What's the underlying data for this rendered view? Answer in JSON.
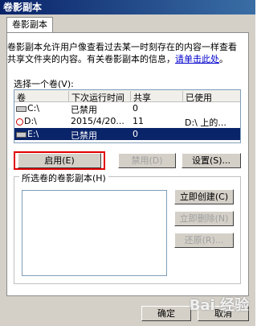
{
  "window": {
    "title": "卷影副本",
    "tab": "卷影副本"
  },
  "description": {
    "text": "卷影副本允许用户像查看过去某一时刻存在的内容一样查看共享文件夹的内容。有关卷影副本的信息，",
    "link": "请单击此处",
    "end": "。"
  },
  "volume_list": {
    "label": "选择一个卷(V):",
    "columns": [
      "卷",
      "下次运行时间",
      "共享",
      "已使用"
    ],
    "rows": [
      {
        "vol": "C:\\",
        "next": "已禁用",
        "shares": "0",
        "used": "",
        "icon": "drive-icon",
        "selected": false
      },
      {
        "vol": "D:\\",
        "next": "2015/4/20...",
        "shares": "11",
        "used": "D:\\ 上的...",
        "icon": "clock-drive-icon",
        "selected": false
      },
      {
        "vol": "E:\\",
        "next": "已禁用",
        "shares": "0",
        "used": "",
        "icon": "drive-icon",
        "selected": true
      }
    ]
  },
  "buttons": {
    "enable": "启用(E)",
    "disable": "禁用(D)",
    "settings": "设置(S)...",
    "create_now": "立即创建(C)",
    "delete_now": "立即删除(N)",
    "revert": "还原(R)...",
    "ok": "确定",
    "cancel": "取消"
  },
  "shadow_group": {
    "label": "所选卷的卷影副本(H)"
  },
  "watermark": "Bai 经验"
}
